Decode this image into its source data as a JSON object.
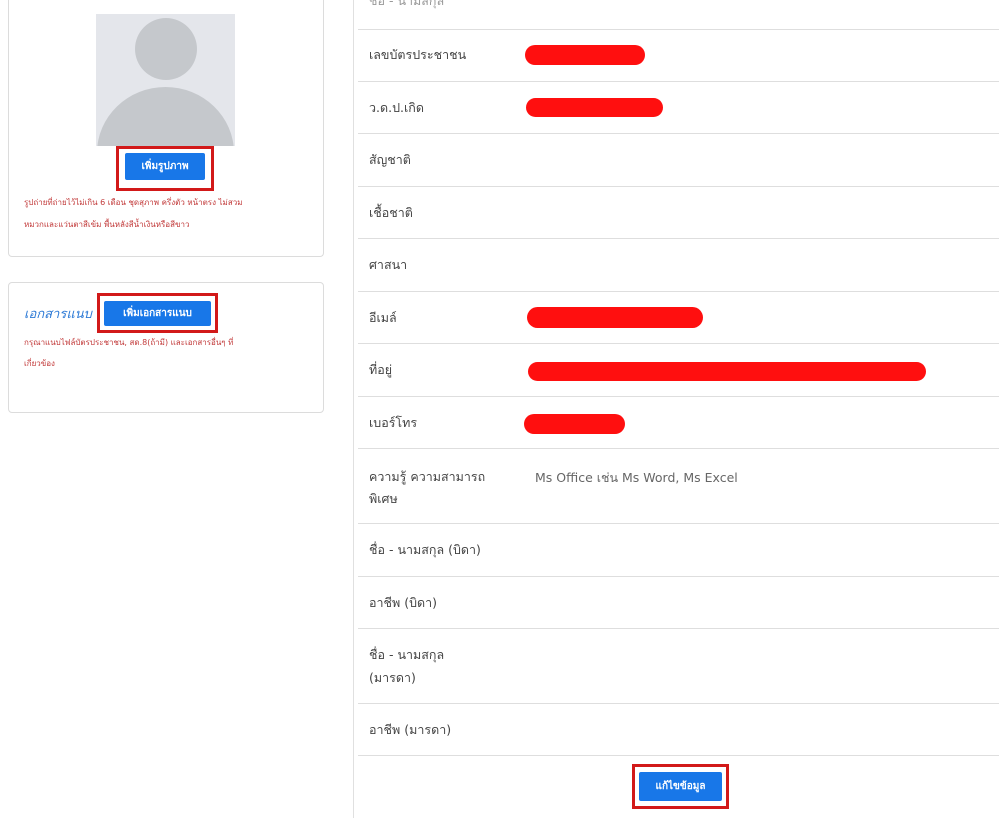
{
  "photo": {
    "add_photo_button": "เพิ่มรูปภาพ",
    "note_line1": "รูปถ่ายที่ถ่ายไว้ไม่เกิน 6 เดือน ชุดสุภาพ ครึ่งตัว หน้าตรง ไม่สวม",
    "note_line2": "หมวกและแว่นตาสีเข้ม พื้นหลังสีน้ำเงินหรือสีขาว"
  },
  "attachments": {
    "title": "เอกสารแนบ",
    "add_button": "เพิ่มเอกสารแนบ",
    "note_line1": "กรุณาแนบไฟล์บัตรประชาชน, สด.8(ถ้ามี) และเอกสารอื่นๆ ที่",
    "note_line2": "เกี่ยวข้อง"
  },
  "profile": {
    "rows": [
      {
        "label": "ชื่อ - นามสกุล",
        "value": ""
      },
      {
        "label": "เลขบัตรประชาชน",
        "value": ""
      },
      {
        "label": "ว.ด.ป.เกิด",
        "value": ""
      },
      {
        "label": "สัญชาติ",
        "value": ""
      },
      {
        "label": "เชื้อชาติ",
        "value": ""
      },
      {
        "label": "ศาสนา",
        "value": ""
      },
      {
        "label": "อีเมล์",
        "value": ""
      },
      {
        "label": "ที่อยู่",
        "value": ""
      },
      {
        "label": "เบอร์โทร",
        "value": ""
      },
      {
        "label": "ความรู้ ความสามารถพิเศษ",
        "label_line1": "ความรู้ ความสามารถ",
        "label_line2": "พิเศษ",
        "value": "Ms Office เช่น Ms Word, Ms Excel"
      },
      {
        "label": "ชื่อ - นามสกุล (บิดา)",
        "value": ""
      },
      {
        "label": "อาชีพ (บิดา)",
        "value": ""
      },
      {
        "label": "ชื่อ - นามสกุล (มารดา)",
        "label_line1": "ชื่อ - นามสกุล",
        "label_line2": "(มารดา)",
        "value": ""
      },
      {
        "label": "อาชีพ (มารดา)",
        "value": ""
      }
    ],
    "edit_button": "แก้ไขข้อมูล"
  },
  "colors": {
    "primary": "#1877e8",
    "highlight": "#d21919",
    "redaction": "#ff0f0f",
    "note_text": "#c23a3a"
  }
}
